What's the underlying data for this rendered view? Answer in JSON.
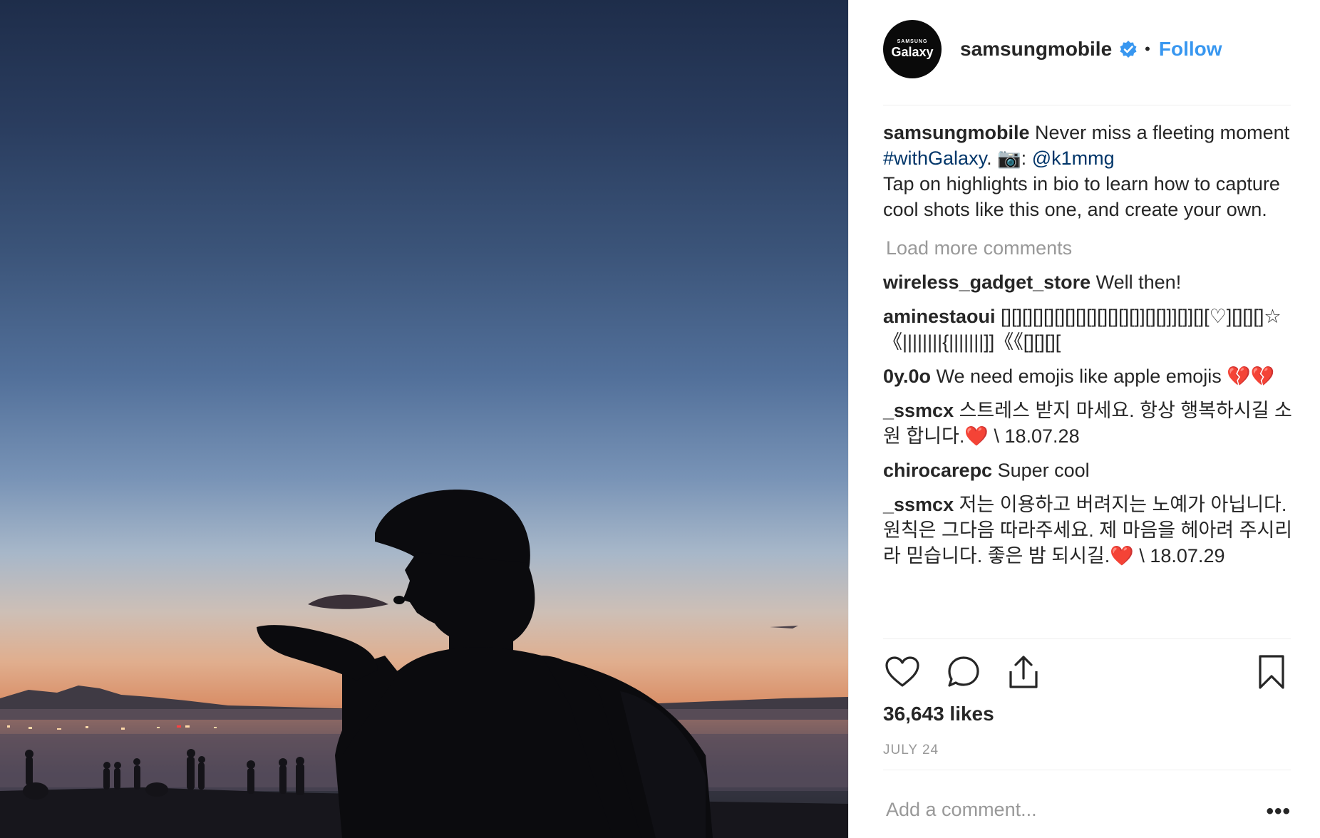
{
  "account": {
    "username": "samsungmobile",
    "avatar_brand_small": "SAMSUNG",
    "avatar_brand_big": "Galaxy",
    "dot": "•",
    "follow_label": "Follow",
    "verified_icon": "verified-badge-icon"
  },
  "caption": {
    "username": "samsungmobile",
    "text_before": " Never miss a fleeting moment ",
    "hashtag": "#withGalaxy",
    "text_mid": ". 📷: ",
    "mention": "@k1mmg",
    "text_after": "Tap on highlights in bio to learn how to capture cool shots like this one, and create your own."
  },
  "load_more": "Load more comments",
  "comments": [
    {
      "user": "wireless_gadget_store",
      "text": " Well then!"
    },
    {
      "user": "aminestaoui",
      "text": " [][][][][][][][][][][][][]][][]]][]][][♡][][][]☆《||||||||{|||||||]]《《[][][]["
    },
    {
      "user": "0y.0o",
      "text": " We need emojis like apple emojis 💔💔"
    },
    {
      "user": "_ssmcx",
      "text": " 스트레스 받지 마세요. 항상 행복하시길 소원 합니다.❤️ \\ 18.07.28"
    },
    {
      "user": "chirocarepc",
      "text": " Super cool"
    },
    {
      "user": "_ssmcx",
      "text": " 저는 이용하고 버려지는 노예가 아닙니다. 원칙은 그다음 따라주세요. 제 마음을 헤아려 주시리라 믿습니다. 좋은 밤 되시길.❤️ \\ 18.07.29"
    }
  ],
  "actions": {
    "like_icon": "heart-icon",
    "comment_icon": "comment-bubble-icon",
    "share_icon": "share-icon",
    "save_icon": "bookmark-icon"
  },
  "likes": "36,643 likes",
  "date": "JULY 24",
  "add_comment": {
    "placeholder": "Add a comment...",
    "more_label": "•••"
  },
  "colors": {
    "link_blue": "#3897f0",
    "hashtag": "#003569",
    "muted": "#999999",
    "text": "#262626"
  }
}
